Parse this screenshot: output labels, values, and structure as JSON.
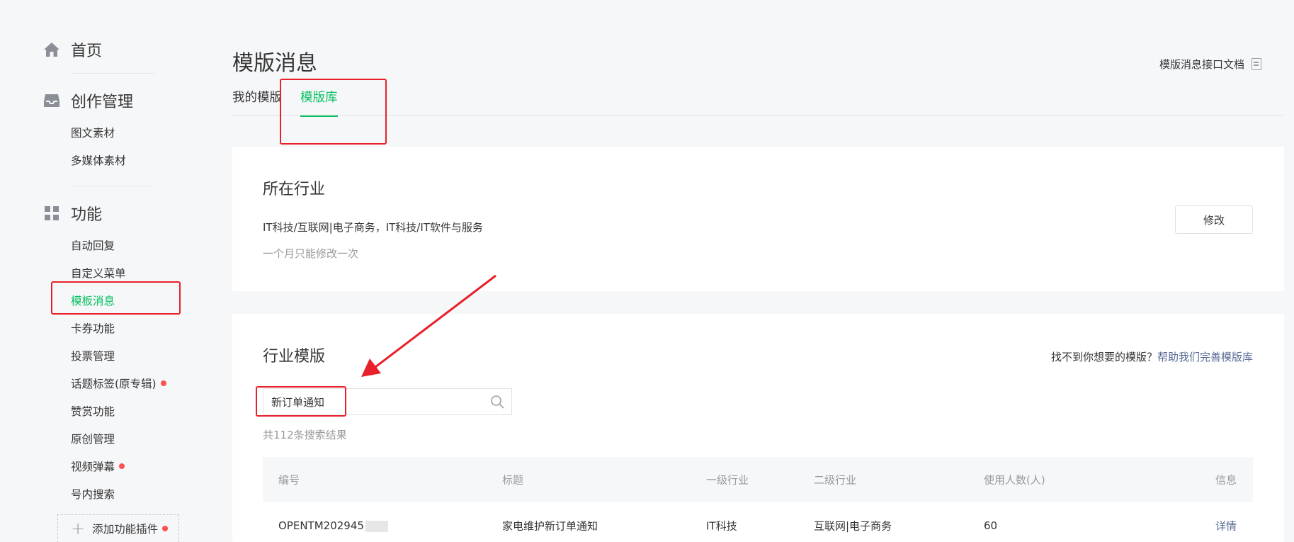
{
  "sidebar": {
    "home": {
      "label": "首页"
    },
    "creation": {
      "label": "创作管理",
      "items": [
        {
          "label": "图文素材"
        },
        {
          "label": "多媒体素材"
        }
      ]
    },
    "features": {
      "label": "功能",
      "items": [
        {
          "label": "自动回复"
        },
        {
          "label": "自定义菜单"
        },
        {
          "label": "模板消息"
        },
        {
          "label": "卡券功能"
        },
        {
          "label": "投票管理"
        },
        {
          "label": "话题标签(原专辑)"
        },
        {
          "label": "赞赏功能"
        },
        {
          "label": "原创管理"
        },
        {
          "label": "视频弹幕"
        },
        {
          "label": "号内搜索"
        }
      ]
    },
    "add_plugin": {
      "label": "添加功能插件"
    }
  },
  "main": {
    "title": "模版消息",
    "doc_link": "模版消息接口文档",
    "tabs": [
      {
        "label": "我的模版"
      },
      {
        "label": "模版库"
      }
    ],
    "industry_card": {
      "title": "所在行业",
      "value": "IT科技/互联网|电子商务，IT科技/IT软件与服务",
      "note": "一个月只能修改一次",
      "modify_button": "修改"
    },
    "template_card": {
      "title": "行业模版",
      "help_text": "找不到你想要的模版？",
      "help_link": "帮助我们完善模版库",
      "search": {
        "value": "新订单通知"
      },
      "result_count": "共112条搜索结果",
      "table": {
        "headers": [
          "编号",
          "标题",
          "一级行业",
          "二级行业",
          "使用人数(人)",
          "信息"
        ],
        "rows": [
          {
            "id": "OPENTM202945",
            "title": "家电维护新订单通知",
            "industry1": "IT科技",
            "industry2": "互联网|电子商务",
            "users": "60",
            "action": "详情"
          }
        ]
      }
    }
  },
  "colors": {
    "accent": "#07c160",
    "link": "#576b95",
    "annotation": "#e8202a",
    "badge": "#fa5151"
  }
}
